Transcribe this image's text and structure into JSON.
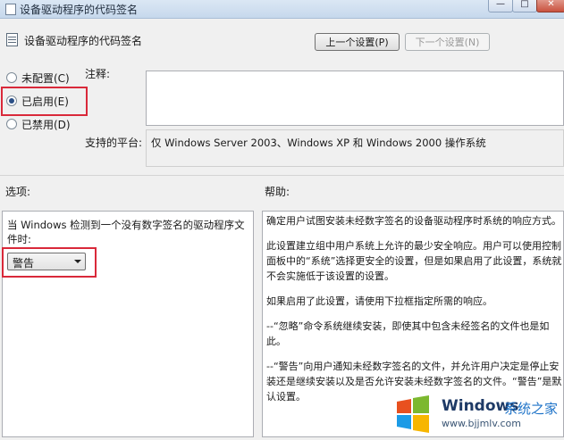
{
  "window": {
    "title": "设备驱动程序的代码签名",
    "buttons": [
      "—",
      "□",
      "✕"
    ]
  },
  "header": {
    "title": "设备驱动程序的代码签名",
    "prev_button": "上一个设置(P)",
    "next_button": "下一个设置(N)"
  },
  "state": {
    "options": [
      {
        "label": "未配置(C)",
        "checked": false
      },
      {
        "label": "已启用(E)",
        "checked": true
      },
      {
        "label": "已禁用(D)",
        "checked": false
      }
    ]
  },
  "comment": {
    "label": "注释:",
    "value": ""
  },
  "platform": {
    "label": "支持的平台:",
    "value": "仅 Windows Server 2003、Windows XP 和 Windows 2000 操作系统"
  },
  "options_pane": {
    "label": "选项:",
    "description": "当 Windows 检测到一个没有数字签名的驱动程序文件时:",
    "combo_value": "警告"
  },
  "help_pane": {
    "label": "帮助:",
    "paragraphs": [
      "确定用户试图安装未经数字签名的设备驱动程序时系统的响应方式。",
      "此设置建立组中用户系统上允许的最少安全响应。用户可以使用控制面板中的“系统”选择更安全的设置，但是如果启用了此设置，系统就不会实施低于该设置的设置。",
      "如果启用了此设置，请使用下拉框指定所需的响应。",
      "--“忽略”命令系统继续安装，即使其中包含未经签名的文件也是如此。",
      "--“警告”向用户通知未经数字签名的文件，并允许用户决定是停止安装还是继续安装以及是否允许安装未经数字签名的文件。“警告”是默认设置。"
    ]
  },
  "watermark": {
    "brand": "Windows",
    "suffix": "系统之家",
    "url": "www.bjjmlv.com"
  },
  "colors": {
    "highlight": "#d9293a",
    "watermark_blue": "#1e73c8"
  }
}
